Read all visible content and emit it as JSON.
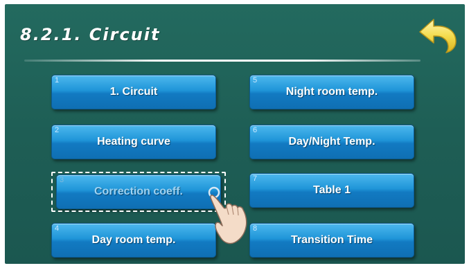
{
  "title": "8.2.1. Circuit",
  "buttons": [
    {
      "num": "1",
      "label": "1. Circuit"
    },
    {
      "num": "2",
      "label": "Heating curve"
    },
    {
      "num": "3",
      "label": "Correction coeff."
    },
    {
      "num": "4",
      "label": "Day room temp."
    },
    {
      "num": "5",
      "label": "Night room temp."
    },
    {
      "num": "6",
      "label": "Day/Night Temp."
    },
    {
      "num": "7",
      "label": "Table 1"
    },
    {
      "num": "8",
      "label": "Transition Time"
    }
  ],
  "selected_button": "Correction coeff.",
  "icons": {
    "back": "back-arrow-icon",
    "pointer": "pointing-hand-icon"
  },
  "colors": {
    "background": "#1f5f55",
    "button": "#1f95d8",
    "back_arrow": "#f2d44a"
  }
}
